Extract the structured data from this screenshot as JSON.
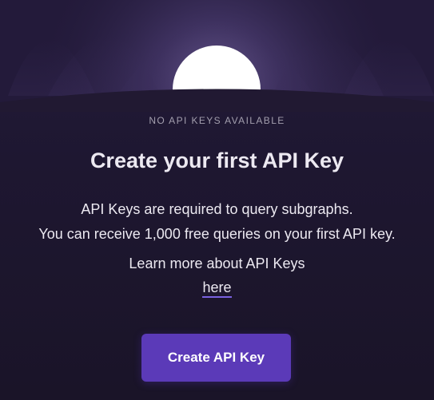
{
  "empty_state": {
    "status_label": "NO API KEYS AVAILABLE",
    "title": "Create your first API Key",
    "description_line_1": "API Keys are required to query subgraphs.",
    "description_line_2": "You can receive 1,000 free queries on your first API key.",
    "learn_more_text": "Learn more about API Keys",
    "learn_more_link": "here",
    "create_button": "Create API Key"
  },
  "colors": {
    "background": "#1f1830",
    "button": "#5b3ab8",
    "link_underline": "#7a62e0",
    "text": "#ece9f1",
    "muted_text": "#a39fae"
  }
}
